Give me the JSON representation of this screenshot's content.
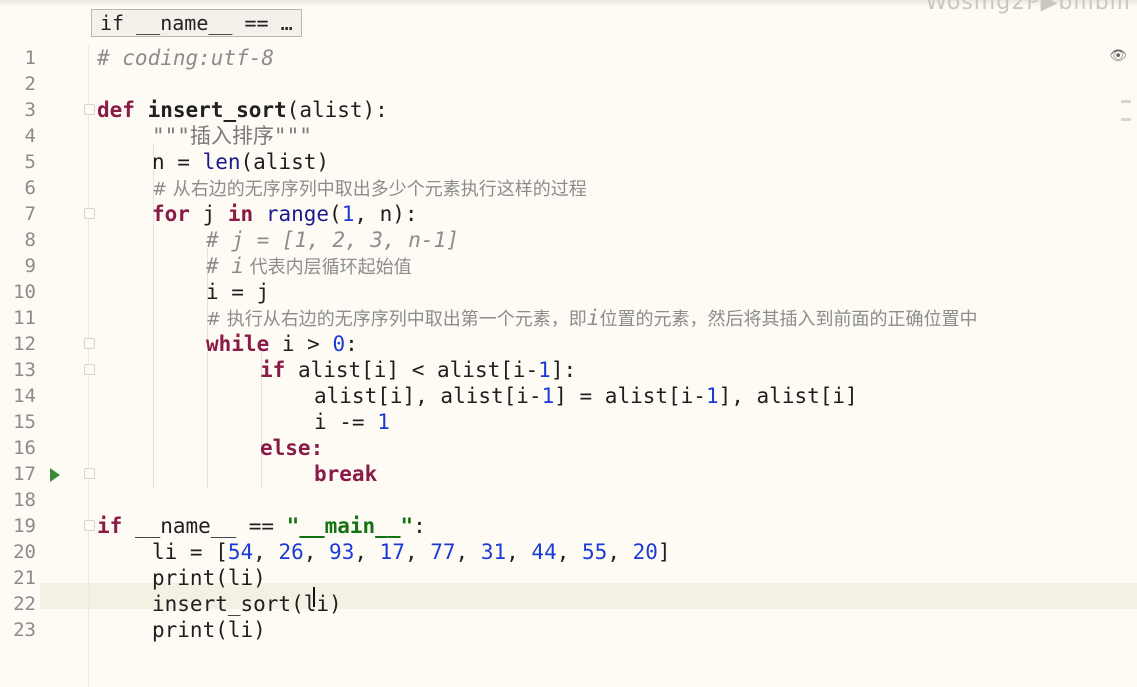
{
  "breadcrumb": "if __name__ == …",
  "watermark": "Wosmg2P▶bilibili",
  "lines": [
    {
      "num": "1"
    },
    {
      "num": "2"
    },
    {
      "num": "3"
    },
    {
      "num": "4"
    },
    {
      "num": "5"
    },
    {
      "num": "6"
    },
    {
      "num": "7"
    },
    {
      "num": "8"
    },
    {
      "num": "9"
    },
    {
      "num": "10"
    },
    {
      "num": "11"
    },
    {
      "num": "12"
    },
    {
      "num": "13"
    },
    {
      "num": "14"
    },
    {
      "num": "15"
    },
    {
      "num": "16"
    },
    {
      "num": "17"
    },
    {
      "num": "18"
    },
    {
      "num": "19"
    },
    {
      "num": "20"
    },
    {
      "num": "21"
    },
    {
      "num": "22"
    },
    {
      "num": "23"
    }
  ],
  "code": {
    "l1": "# coding:utf-8",
    "l3_def": "def",
    "l3_name": "insert_sort",
    "l3_rest": "(alist):",
    "l4": "\"\"\"插入排序\"\"\"",
    "l5_a": "n = ",
    "l5_len": "len",
    "l5_b": "(alist)",
    "l6": "# 从右边的无序序列中取出多少个元素执行这样的过程",
    "l7_for": "for",
    "l7_j": " j ",
    "l7_in": "in",
    "l7_range": " range",
    "l7_p1": "(",
    "l7_1": "1",
    "l7_p2": ", n):",
    "l8": "# j = [1, 2, 3, n-1]",
    "l9_a": "# i",
    "l9_b": " 代表内层循环起始值",
    "l10": "i = j",
    "l11_a": "# 执行从右边的无序序列中取出第一个元素，即",
    "l11_i": "i",
    "l11_b": "位置的元素，然后将其插入到前面的正确位置中",
    "l12_while": "while",
    "l12_a": " i > ",
    "l12_0": "0",
    "l12_b": ":",
    "l13_if": "if",
    "l13_a": " alist[i] < alist[i-",
    "l13_1": "1",
    "l13_b": "]:",
    "l14_a": "alist[i], alist[i-",
    "l14_1": "1",
    "l14_b": "] = alist[i-",
    "l14_1b": "1",
    "l14_c": "], alist[i]",
    "l15_a": "i -= ",
    "l15_1": "1",
    "l16": "else:",
    "l17": "break",
    "l19_if": "if",
    "l19_a": " __name__ == ",
    "l19_str": "\"__main__\"",
    "l19_b": ":",
    "l20_a": "li = [",
    "l20_nums": [
      "54",
      "26",
      "93",
      "17",
      "77",
      "31",
      "44",
      "55",
      "20"
    ],
    "l20_b": "]",
    "l21": "print(li)",
    "l22": "insert_sort(li)",
    "l23": "print(li)"
  },
  "icons": {
    "run": "run-gutter-icon",
    "eye": "eye-icon"
  }
}
